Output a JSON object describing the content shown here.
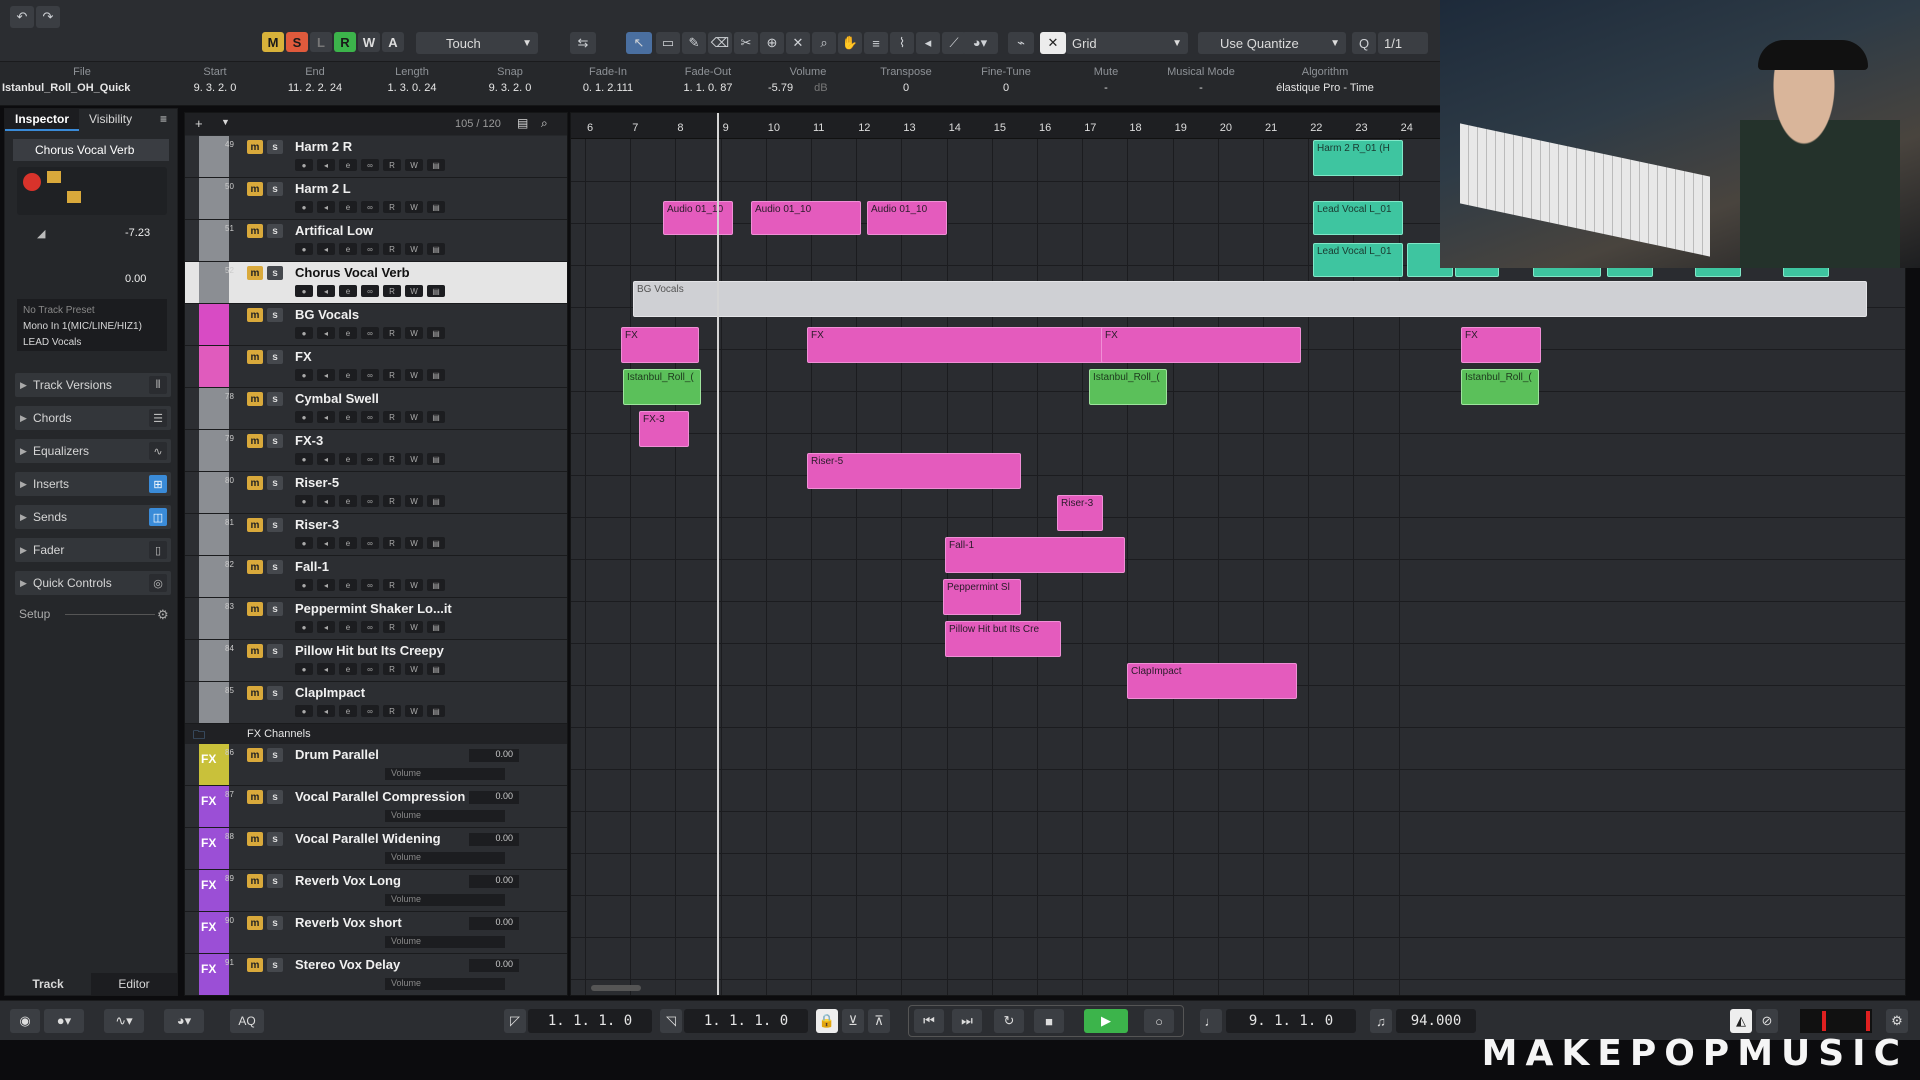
{
  "toolbar": {
    "mode": "Touch",
    "grid": "Grid",
    "quantize": "Use Quantize",
    "quantize_value": "1/1",
    "state_buttons": [
      "M",
      "S",
      "L",
      "R",
      "W",
      "A"
    ]
  },
  "infoline": {
    "columns": [
      {
        "label": "File",
        "value": "Istanbul_Roll_OH_Quick"
      },
      {
        "label": "Start",
        "value": "9. 3. 2.   0"
      },
      {
        "label": "End",
        "value": "11. 2. 2. 24"
      },
      {
        "label": "Length",
        "value": "1. 3. 0. 24"
      },
      {
        "label": "Snap",
        "value": "9. 3. 2.   0"
      },
      {
        "label": "Fade-In",
        "value": "0. 1. 2.111"
      },
      {
        "label": "Fade-Out",
        "value": "1. 1. 0. 87"
      },
      {
        "label": "Volume",
        "value": "-5.79"
      },
      {
        "label": "Transpose",
        "value": "0"
      },
      {
        "label": "Fine-Tune",
        "value": "0"
      },
      {
        "label": "Mute",
        "value": "-"
      },
      {
        "label": "Musical Mode",
        "value": "-"
      },
      {
        "label": "Algorithm",
        "value": "élastique Pro - Time"
      }
    ],
    "volume_unit": "dB"
  },
  "inspector": {
    "tabs": [
      "Inspector",
      "Visibility"
    ],
    "track_name": "Chorus Vocal Verb",
    "volume": "-7.23",
    "pan": "0.00",
    "preset": "No Track Preset",
    "input": "Mono In 1(MIC/LINE/HIZ1)",
    "output": "LEAD Vocals",
    "sections": [
      "Track Versions",
      "Chords",
      "Equalizers",
      "Inserts",
      "Sends",
      "Fader",
      "Quick Controls"
    ],
    "setup": "Setup",
    "bottom_tabs": [
      "Track",
      "Editor"
    ]
  },
  "tracklist": {
    "count": "105 / 120",
    "tracks": [
      {
        "num": "49",
        "name": "Harm 2 R",
        "color": "#8b8e93"
      },
      {
        "num": "50",
        "name": "Harm 2 L",
        "color": "#8b8e93"
      },
      {
        "num": "51",
        "name": "Artifical Low",
        "color": "#8b8e93"
      },
      {
        "num": "52",
        "name": "Chorus Vocal Verb",
        "color": "#8b8e93"
      },
      {
        "num": "",
        "name": "BG Vocals",
        "color": "#d84bc4"
      },
      {
        "num": "",
        "name": "FX",
        "color": "#e05bbd"
      },
      {
        "num": "78",
        "name": "Cymbal Swell",
        "color": "#8b8e93"
      },
      {
        "num": "79",
        "name": "FX-3",
        "color": "#8b8e93"
      },
      {
        "num": "80",
        "name": "Riser-5",
        "color": "#8b8e93"
      },
      {
        "num": "81",
        "name": "Riser-3",
        "color": "#8b8e93"
      },
      {
        "num": "82",
        "name": "Fall-1",
        "color": "#8b8e93"
      },
      {
        "num": "83",
        "name": "Peppermint Shaker Lo...it",
        "color": "#8b8e93"
      },
      {
        "num": "84",
        "name": "Pillow Hit but Its Creepy",
        "color": "#8b8e93"
      },
      {
        "num": "85",
        "name": "ClapImpact",
        "color": "#8b8e93"
      }
    ],
    "fx_folder": "FX Channels",
    "fx_tracks": [
      {
        "num": "86",
        "name": "Drum Parallel",
        "vol": "0.00",
        "color": "#c9c13a"
      },
      {
        "num": "87",
        "name": "Vocal Parallel Compression",
        "vol": "0.00",
        "color": "#9b4fd6"
      },
      {
        "num": "88",
        "name": "Vocal Parallel Widening",
        "vol": "0.00",
        "color": "#9b4fd6"
      },
      {
        "num": "89",
        "name": "Reverb Vox Long",
        "vol": "0.00",
        "color": "#9b4fd6"
      },
      {
        "num": "90",
        "name": "Reverb Vox short",
        "vol": "0.00",
        "color": "#9b4fd6"
      },
      {
        "num": "91",
        "name": "Stereo Vox Delay",
        "vol": "0.00",
        "color": "#9b4fd6"
      }
    ],
    "volume_label": "Volume",
    "fx_tag": "FX"
  },
  "ruler": {
    "bars": [
      "6",
      "7",
      "8",
      "9",
      "10",
      "11",
      "12",
      "13",
      "14",
      "15",
      "16",
      "17",
      "18",
      "19",
      "20",
      "21",
      "22",
      "23",
      "24"
    ]
  },
  "events": [
    {
      "label": "Harm 2 R_01 (H",
      "type": "green"
    },
    {
      "label": "Audio 01_10",
      "type": "pink"
    },
    {
      "label": "Audio 01_10",
      "type": "pink"
    },
    {
      "label": "Audio 01_10",
      "type": "pink"
    },
    {
      "label": "Lead Vocal L_01",
      "type": "green"
    },
    {
      "label": "Lead Vocal L_01",
      "type": "green"
    },
    {
      "label": "Lead Vocal L_01",
      "type": "green"
    },
    {
      "label": "BG Vocals",
      "type": "grey"
    },
    {
      "label": "FX",
      "type": "pink"
    },
    {
      "label": "FX",
      "type": "pink"
    },
    {
      "label": "FX",
      "type": "pink"
    },
    {
      "label": "FX",
      "type": "pink"
    },
    {
      "label": "Istanbul_Roll_(",
      "type": "lgreen"
    },
    {
      "label": "Istanbul_Roll_(",
      "type": "lgreen"
    },
    {
      "label": "Istanbul_Roll_(",
      "type": "lgreen"
    },
    {
      "label": "FX-3",
      "type": "pink"
    },
    {
      "label": "Riser-5",
      "type": "pink"
    },
    {
      "label": "Riser-3",
      "type": "pink"
    },
    {
      "label": "Fall-1",
      "type": "pink"
    },
    {
      "label": "Peppermint Sl",
      "type": "pink"
    },
    {
      "label": "Pillow Hit but Its Cre",
      "type": "pink"
    },
    {
      "label": "ClapImpact",
      "type": "pink"
    }
  ],
  "transport": {
    "left_locator": "1. 1. 1.   0",
    "right_locator": "1. 1. 1.   0",
    "position": "9. 1. 1.   0",
    "tempo": "94.000",
    "aq": "AQ"
  },
  "brand": "MAKEPOPMUSIC",
  "colors": {
    "accent_pink": "#e45bbd",
    "accent_green": "#3ec5a0",
    "play_green": "#3cb44b"
  }
}
